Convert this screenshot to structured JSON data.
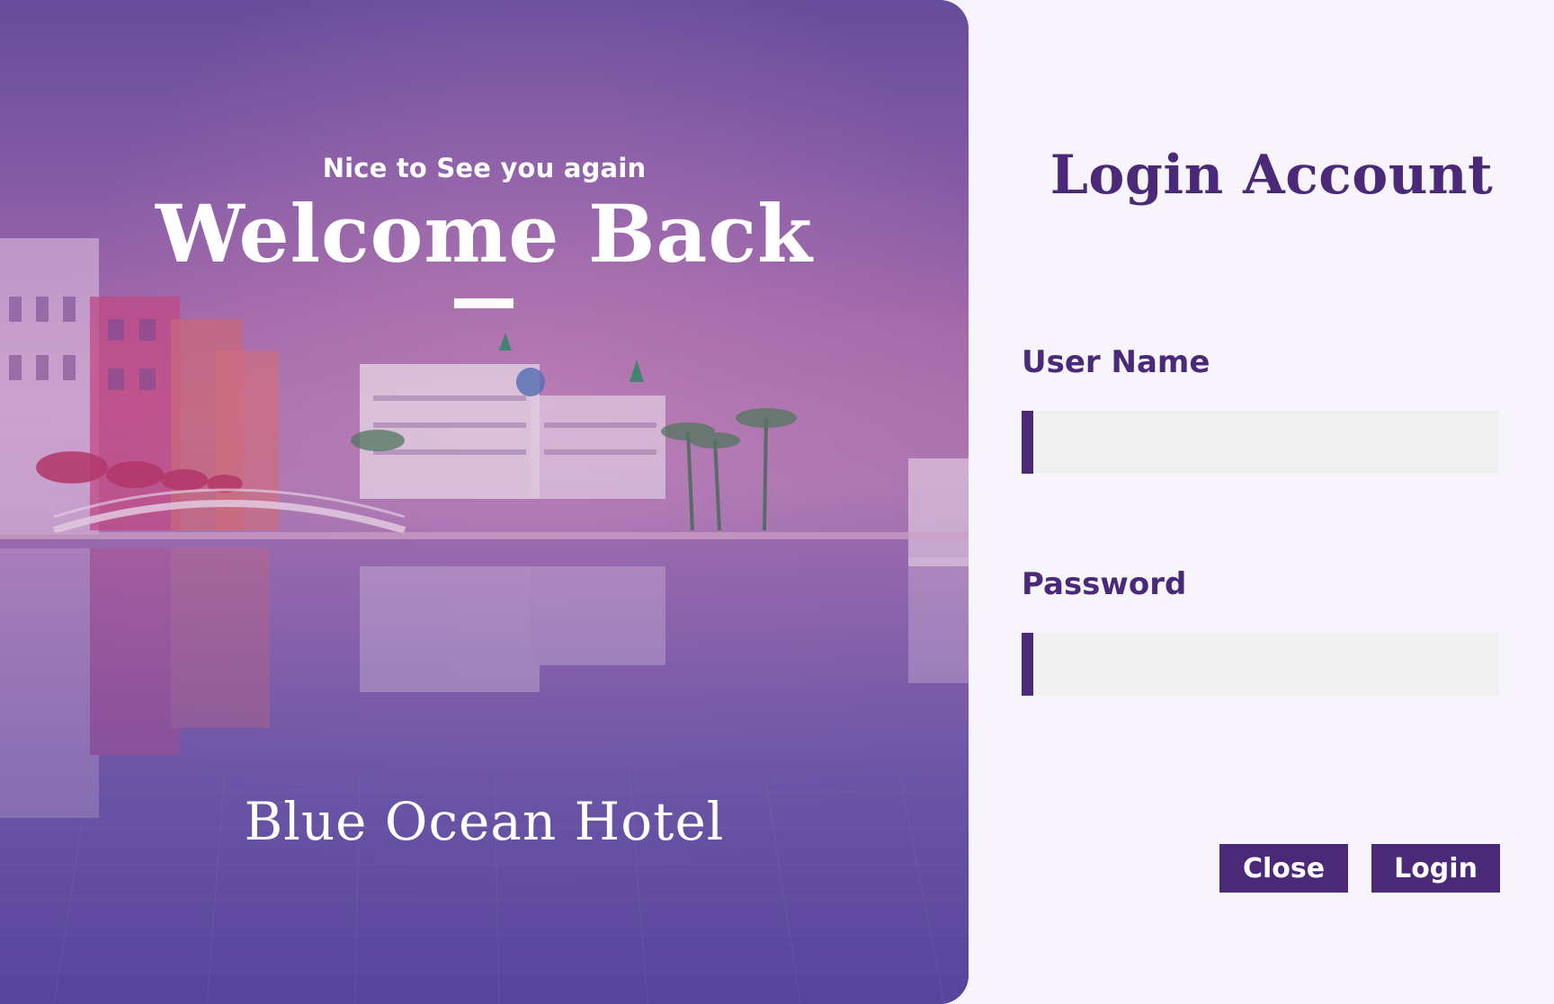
{
  "hero": {
    "greeting": "Nice to See you again",
    "welcome": "Welcome Back",
    "hotel_name": "Blue Ocean Hotel",
    "photo_description_icon": "hotel-resort-photo"
  },
  "login": {
    "title": "Login Account",
    "username": {
      "label": "User Name",
      "value": "",
      "placeholder": ""
    },
    "password": {
      "label": "Password",
      "value": "",
      "placeholder": ""
    },
    "buttons": {
      "close_label": "Close",
      "login_label": "Login"
    }
  },
  "colors": {
    "accent": "#4a2a78",
    "page_background": "#f8f4fb",
    "input_background": "#f0f0f0",
    "hero_overlay": "#8a5ea6"
  }
}
